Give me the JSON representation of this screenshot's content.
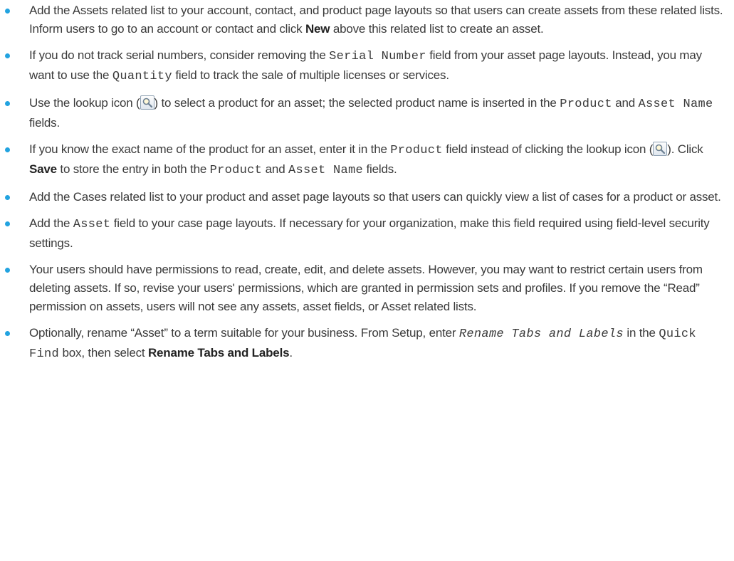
{
  "bullets": [
    {
      "segments": [
        {
          "t": "text",
          "v": "Add the Assets related list to your account, contact, and product page layouts so that users can create assets from these related lists. Inform users to go to an account or contact and click "
        },
        {
          "t": "bold",
          "v": "New"
        },
        {
          "t": "text",
          "v": " above this related list to create an asset."
        }
      ]
    },
    {
      "segments": [
        {
          "t": "text",
          "v": "If you do not track serial numbers, consider removing the "
        },
        {
          "t": "code",
          "v": "Serial Number"
        },
        {
          "t": "text",
          "v": " field from your asset page layouts. Instead, you may want to use the "
        },
        {
          "t": "code",
          "v": "Quantity"
        },
        {
          "t": "text",
          "v": " field to track the sale of multiple licenses or services."
        }
      ]
    },
    {
      "segments": [
        {
          "t": "text",
          "v": "Use the lookup icon ("
        },
        {
          "t": "icon",
          "v": "lookup-icon"
        },
        {
          "t": "text",
          "v": ") to select a product for an asset; the selected product name is inserted in the "
        },
        {
          "t": "code",
          "v": "Product"
        },
        {
          "t": "text",
          "v": " and "
        },
        {
          "t": "code",
          "v": "Asset Name"
        },
        {
          "t": "text",
          "v": " fields."
        }
      ]
    },
    {
      "segments": [
        {
          "t": "text",
          "v": "If you know the exact name of the product for an asset, enter it in the "
        },
        {
          "t": "code",
          "v": "Product"
        },
        {
          "t": "text",
          "v": " field instead of clicking the lookup icon ("
        },
        {
          "t": "icon",
          "v": "lookup-icon"
        },
        {
          "t": "text",
          "v": "). Click "
        },
        {
          "t": "bold",
          "v": "Save"
        },
        {
          "t": "text",
          "v": " to store the entry in both the "
        },
        {
          "t": "code",
          "v": "Product"
        },
        {
          "t": "text",
          "v": " and "
        },
        {
          "t": "code",
          "v": "Asset Name"
        },
        {
          "t": "text",
          "v": " fields."
        }
      ]
    },
    {
      "segments": [
        {
          "t": "text",
          "v": "Add the Cases related list to your product and asset page layouts so that users can quickly view a list of cases for a product or asset."
        }
      ]
    },
    {
      "segments": [
        {
          "t": "text",
          "v": "Add the "
        },
        {
          "t": "code",
          "v": "Asset"
        },
        {
          "t": "text",
          "v": " field to your case page layouts. If necessary for your organization, make this field required using field-level security settings."
        }
      ]
    },
    {
      "segments": [
        {
          "t": "text",
          "v": "Your users should have permissions to read, create, edit, and delete assets. However, you may want to restrict certain users from deleting assets. If so, revise your users' permissions, which are granted in permission sets and profiles. If you remove the “Read” permission on assets, users will not see any assets, asset fields, or Asset related lists."
        }
      ]
    },
    {
      "segments": [
        {
          "t": "text",
          "v": "Optionally, rename “Asset” to a term suitable for your business. From Setup, enter "
        },
        {
          "t": "code-italic",
          "v": "Rename Tabs and Labels"
        },
        {
          "t": "text",
          "v": " in the "
        },
        {
          "t": "code",
          "v": "Quick Find"
        },
        {
          "t": "text",
          "v": " box, then select "
        },
        {
          "t": "bold",
          "v": "Rename Tabs and Labels"
        },
        {
          "t": "text",
          "v": "."
        }
      ]
    }
  ],
  "colors": {
    "bullet": "#22a3e0",
    "text": "#3a3a3a"
  }
}
